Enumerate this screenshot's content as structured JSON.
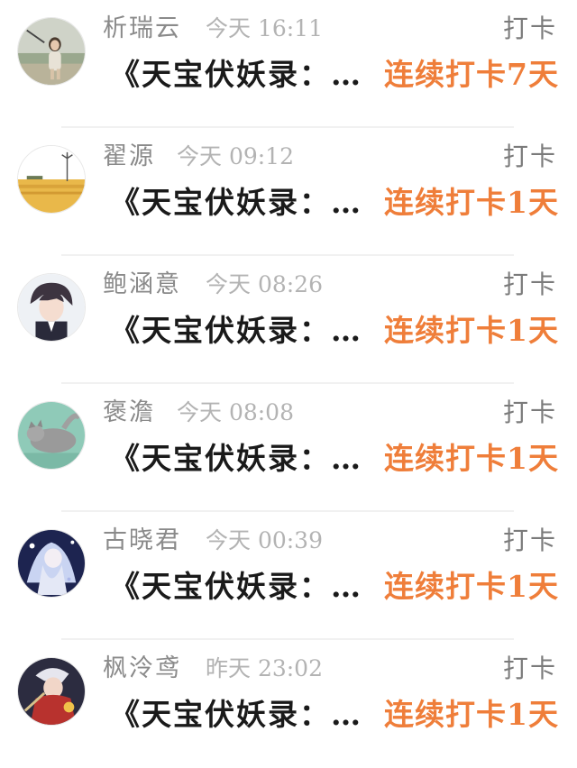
{
  "feed": {
    "items": [
      {
        "name": "析瑞云",
        "time": "今天 16:11",
        "action": "打卡",
        "book": "《天宝伏妖录：…",
        "streak": "连续打卡7天",
        "avatar_icon": "girl-photo-avatar"
      },
      {
        "name": "翟源",
        "time": "今天 09:12",
        "action": "打卡",
        "book": "《天宝伏妖录：…",
        "streak": "连续打卡1天",
        "avatar_icon": "windmill-field-avatar"
      },
      {
        "name": "鲍涵意",
        "time": "今天 08:26",
        "action": "打卡",
        "book": "《天宝伏妖录：…",
        "streak": "连续打卡1天",
        "avatar_icon": "anime-boy-avatar"
      },
      {
        "name": "褒澹",
        "time": "今天 08:08",
        "action": "打卡",
        "book": "《天宝伏妖录：…",
        "streak": "连续打卡1天",
        "avatar_icon": "cat-avatar"
      },
      {
        "name": "古晓君",
        "time": "今天 00:39",
        "action": "打卡",
        "book": "《天宝伏妖录：…",
        "streak": "连续打卡1天",
        "avatar_icon": "anime-angel-avatar"
      },
      {
        "name": "枫泠鸢",
        "time": "昨天 23:02",
        "action": "打卡",
        "book": "《天宝伏妖录：…",
        "streak": "连续打卡1天",
        "avatar_icon": "anime-warrior-avatar"
      }
    ]
  },
  "colors": {
    "streak": "#ef7e3a",
    "name": "#8a8a8a",
    "time": "#b3b3b3",
    "book": "#1a1a1a",
    "divider": "#f1f1f1"
  }
}
